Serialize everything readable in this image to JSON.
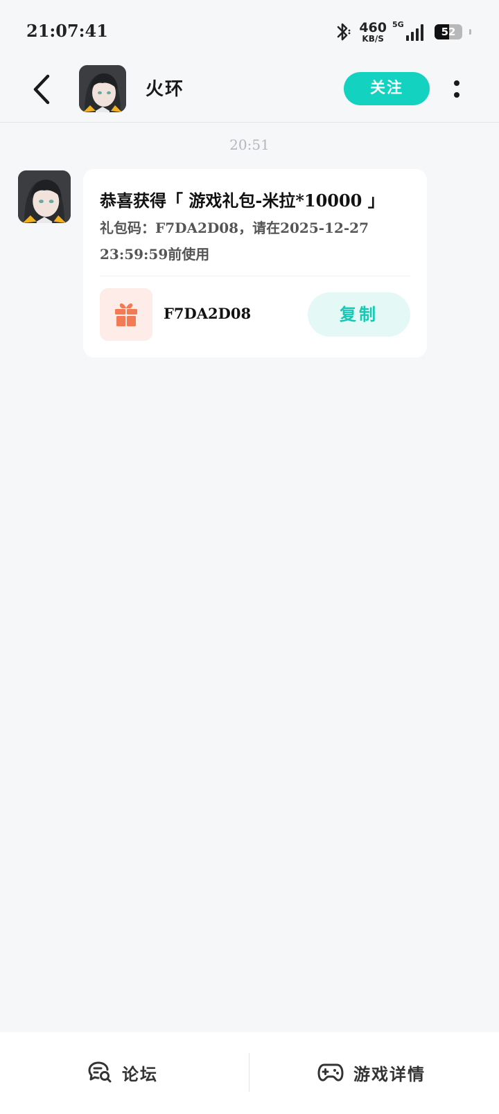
{
  "status_bar": {
    "time": "21:07:41",
    "net_speed_value": "460",
    "net_speed_unit": "KB/S",
    "network_type": "5G",
    "battery_level": "52",
    "battery_fraction": 0.52
  },
  "header": {
    "title": "火环",
    "follow_label": "关注"
  },
  "chat": {
    "timestamp": "20:51",
    "message": {
      "title": "恭喜获得「 游戏礼包-米拉*10000 」",
      "description": "礼包码：F7DA2D08，请在2025-12-27 23:59:59前使用",
      "gift_code": "F7DA2D08",
      "copy_label": "复制"
    }
  },
  "bottom_bar": {
    "forum_label": "论坛",
    "details_label": "游戏详情"
  },
  "colors": {
    "accent": "#14d2c0",
    "gift_bg": "#fdece8",
    "gift_icon": "#f27a55",
    "copy_bg": "#e4f9f6"
  },
  "icons": [
    "back-arrow-icon",
    "more-vertical-icon",
    "bluetooth-icon",
    "signal-icon",
    "battery-icon",
    "gift-icon",
    "forum-chat-icon",
    "gamepad-icon"
  ]
}
